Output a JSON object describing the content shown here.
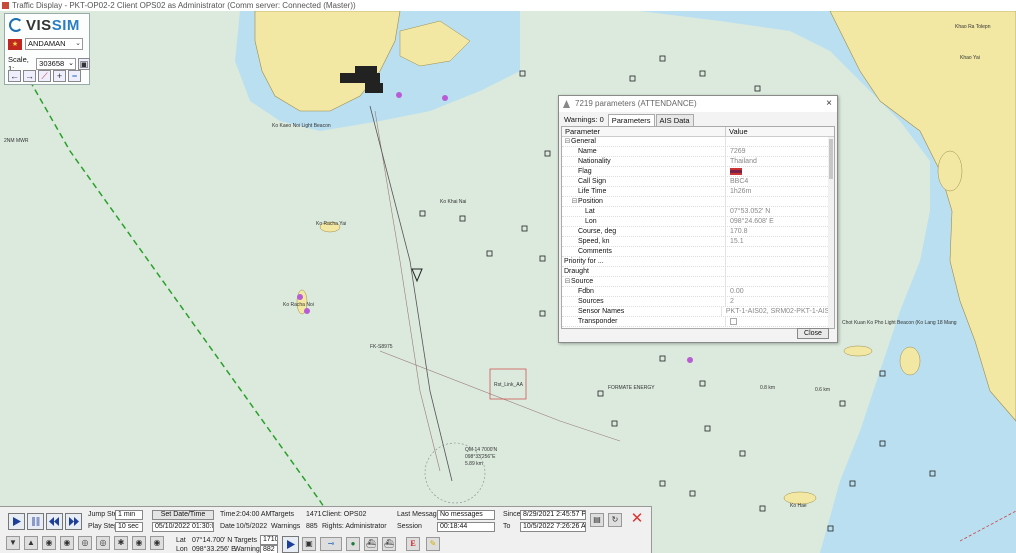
{
  "window": {
    "title": "Traffic Display - PKT-OP02-2 Client OPS02 as Administrator (Comm server: Connected (Master))"
  },
  "logo": {
    "text_vis": "VIS",
    "text_sim": "SIM"
  },
  "region": {
    "flag_label": "★",
    "selected": "ANDAMAN"
  },
  "scale": {
    "label": "Scale, 1:",
    "value": "303658"
  },
  "map_labels": {
    "right_top_1": "Khao Ra Tolepn",
    "right_top_2": "Khao Yai",
    "left_island_1": "Ko Racha Yai",
    "left_island_2": "Ko Racha Noi",
    "top_beacon": "Ko Kaeo Noi Light Beacon",
    "light_beacon_right": "Chot Kuan Ko Pho Light Beacon (Ko Lang 18 Mang",
    "energy": "FORMATE ENERGY",
    "area_box": "Rst_Link_AA",
    "track_label_1": "QM 14 7000'N",
    "track_label_2": "098°33'256''E",
    "track_label_3": "5.89 km",
    "distance_1": "0.8 km",
    "distance_2": "0.6 km",
    "mwwr": "2NM MWR",
    "lane_label": "FK-S8975",
    "west_label": "Ko Khai Nai",
    "ko_hae": "Ko Hae"
  },
  "dialog": {
    "title": "7219 parameters (ATTENDANCE)",
    "close_x": "×",
    "tabs": [
      "Warnings: 0",
      "Parameters",
      "AIS Data"
    ],
    "active_tab": 1,
    "columns": {
      "parameter": "Parameter",
      "value": "Value"
    },
    "rows": [
      {
        "indent": 0,
        "expander": "⊟",
        "name": "General",
        "value": ""
      },
      {
        "indent": 2,
        "expander": "",
        "name": "Name",
        "value": "7269"
      },
      {
        "indent": 2,
        "expander": "",
        "name": "Nationality",
        "value": "Thailand"
      },
      {
        "indent": 2,
        "expander": "",
        "name": "Flag",
        "value": "",
        "flag": true
      },
      {
        "indent": 2,
        "expander": "",
        "name": "Call Sign",
        "value": "BBC4"
      },
      {
        "indent": 2,
        "expander": "",
        "name": "Life Time",
        "value": "1h26m"
      },
      {
        "indent": 1,
        "expander": "⊟",
        "name": "Position",
        "value": ""
      },
      {
        "indent": 3,
        "expander": "",
        "name": "Lat",
        "value": "07°53.052' N"
      },
      {
        "indent": 3,
        "expander": "",
        "name": "Lon",
        "value": "098°24.608' E"
      },
      {
        "indent": 2,
        "expander": "",
        "name": "Course, deg",
        "value": "170.8"
      },
      {
        "indent": 2,
        "expander": "",
        "name": "Speed, kn",
        "value": "15.1"
      },
      {
        "indent": 2,
        "expander": "",
        "name": "Comments",
        "value": ""
      },
      {
        "indent": 0,
        "expander": "",
        "name": "Priority for ...",
        "value": ""
      },
      {
        "indent": 0,
        "expander": "",
        "name": "Draught",
        "value": ""
      },
      {
        "indent": 0,
        "expander": "⊟",
        "name": "Source",
        "value": ""
      },
      {
        "indent": 2,
        "expander": "",
        "name": "Fdbn",
        "value": "0.00"
      },
      {
        "indent": 2,
        "expander": "",
        "name": "Sources",
        "value": "2"
      },
      {
        "indent": 2,
        "expander": "",
        "name": "Sensor Names",
        "value": "PKT-1-AIS02, SRM02-PKT-1-AIS02"
      },
      {
        "indent": 2,
        "expander": "",
        "name": "Transponder",
        "value": "",
        "check": true
      }
    ],
    "close_button": "Close"
  },
  "bottom": {
    "jump_step_label": "Jump Step",
    "jump_step_value": "1 min",
    "play_step_label": "Play Step",
    "play_step_value": "10 sec",
    "set_datetime": "Set Date/Time",
    "datetime_value": "05/10/2022 01:30:00",
    "time_label": "Time",
    "time_value": "2:04:00 AM",
    "date_label": "Date",
    "date_value": "10/5/2022",
    "targets_label": "Targets",
    "targets_value": "1471",
    "warnings_label": "Warnings",
    "warnings_value": "885",
    "client_text": "Client: OPS02",
    "rights_text": "Rights: Administrator",
    "last_message_label": "Last Message",
    "last_message_value": "No messages",
    "session_label": "Session",
    "session_value": "00:18:44",
    "since_label": "Since",
    "since_value": "8/29/2021 2:45:57 PM",
    "to_label": "To",
    "to_value": "10/5/2022 7:26:26 AM",
    "lat_label": "Lat",
    "lat_value": "07°14.700' N",
    "lon_label": "Lon",
    "lon_value": "098°33.256' E",
    "targets2_label": "Targets",
    "targets2_value": "1710",
    "warnings2_label": "Warnings",
    "warnings2_value": "882"
  },
  "colors": {
    "sea": "#dbeadd",
    "shallow": "#b9dff0",
    "land": "#f2e8a4",
    "safety_line": "#2aa02a",
    "route": "#555555",
    "accent_blue": "#1f6fb2"
  }
}
